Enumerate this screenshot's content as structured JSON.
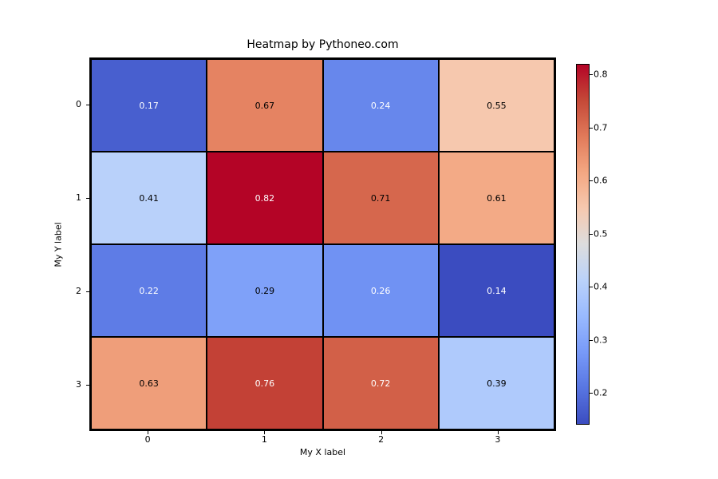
{
  "chart_data": {
    "type": "heatmap",
    "title": "Heatmap by Pythoneo.com",
    "xlabel": "My X label",
    "ylabel": "My Y label",
    "x_categories": [
      "0",
      "1",
      "2",
      "3"
    ],
    "y_categories": [
      "0",
      "1",
      "2",
      "3"
    ],
    "values": [
      [
        0.17,
        0.67,
        0.24,
        0.55
      ],
      [
        0.41,
        0.82,
        0.71,
        0.61
      ],
      [
        0.22,
        0.29,
        0.26,
        0.14
      ],
      [
        0.63,
        0.76,
        0.72,
        0.39
      ]
    ],
    "vmin": 0.14,
    "vmax": 0.82,
    "colormap": "coolwarm",
    "colorbar_ticks": [
      "0.2",
      "0.3",
      "0.4",
      "0.5",
      "0.6",
      "0.7",
      "0.8"
    ],
    "colorbar_tick_values": [
      0.2,
      0.3,
      0.4,
      0.5,
      0.6,
      0.7,
      0.8
    ],
    "x_extent": [
      -0.5,
      3.5
    ],
    "y_extent": [
      -0.5,
      3.5
    ],
    "annotations_fmt": "0.2f"
  }
}
